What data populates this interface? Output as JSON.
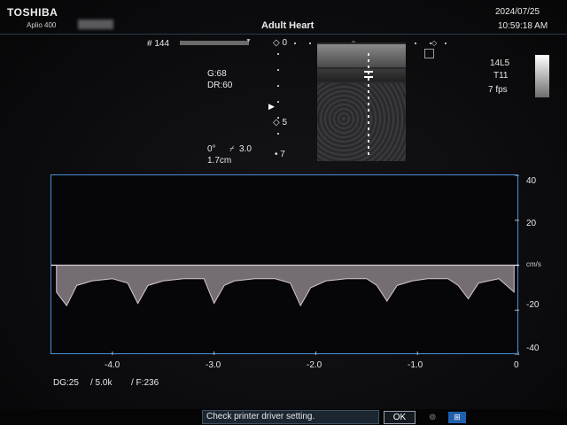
{
  "header": {
    "brand": "TOSHIBA",
    "model": "Aplio 400",
    "patient_id_redacted": "",
    "preset": "Adult Heart",
    "date": "2024/07/25",
    "time": "10:59:18 AM"
  },
  "image_params": {
    "frame": "# 144",
    "gain": "G:68",
    "dynamic_range": "DR:60",
    "angle": "0°",
    "angle_correct": "3.0",
    "sample_depth": "1.7cm",
    "depth_marks": [
      "0",
      "5",
      "7"
    ]
  },
  "probe": {
    "transducer": "14L5",
    "preset_code": "T11",
    "frame_rate": "7 fps"
  },
  "doppler": {
    "unit": "cm/s",
    "y_ticks": [
      "40",
      "20",
      "-20",
      "-40"
    ],
    "x_ticks": [
      "-4.0",
      "-3.0",
      "-2.0",
      "-1.0",
      "0"
    ],
    "status_line": [
      "DG:25",
      "/ 5.0k",
      "/ F:236"
    ]
  },
  "dialog": {
    "message": "Check printer driver setting.",
    "ok_label": "OK"
  },
  "colors": {
    "frame_border": "#4b8fd6",
    "baseline": "#f2f2f2",
    "message_bg": "#1b2631"
  },
  "chart_data": {
    "type": "line",
    "title": "",
    "xlabel": "",
    "ylabel": "cm/s",
    "xlim": [
      -4.6,
      0
    ],
    "ylim": [
      -40,
      40
    ],
    "x_ticks": [
      -4.0,
      -3.0,
      -2.0,
      -1.0,
      0
    ],
    "y_ticks": [
      40,
      20,
      -20,
      -40
    ],
    "baseline": 0,
    "grid": false,
    "series": [
      {
        "x": [
          -4.55,
          -4.45,
          -4.35,
          -4.2,
          -4.0,
          -3.85,
          -3.75,
          -3.65,
          -3.5,
          -3.3,
          -3.1,
          -3.0,
          -2.9,
          -2.8,
          -2.6,
          -2.4,
          -2.25,
          -2.15,
          -2.05,
          -1.9,
          -1.7,
          -1.5,
          -1.4,
          -1.3,
          -1.2,
          -1.05,
          -0.9,
          -0.7,
          -0.6,
          -0.5,
          -0.4,
          -0.2,
          -0.05
        ],
        "y": [
          -12,
          -18,
          -9,
          -7,
          -6,
          -8,
          -17,
          -9,
          -7,
          -6,
          -6,
          -17,
          -9,
          -7,
          -6,
          -6,
          -8,
          -18,
          -10,
          -7,
          -6,
          -6,
          -9,
          -16,
          -9,
          -7,
          -6,
          -6,
          -9,
          -15,
          -8,
          -6,
          -12
        ]
      }
    ]
  }
}
